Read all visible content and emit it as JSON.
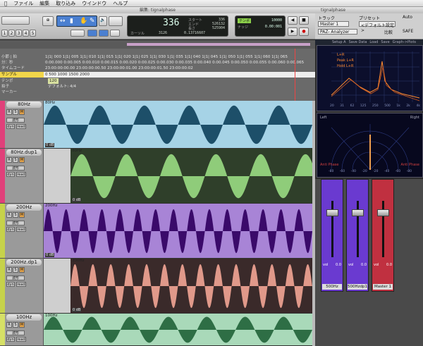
{
  "menu": [
    "ファイル",
    "編集",
    "取り込み",
    "ウインドウ",
    "ヘルプ"
  ],
  "edit_window_title": "編集: tignalphase",
  "plugin_window_title": "tignalphase",
  "counter": {
    "main": "336",
    "start_label": "スタート",
    "end_label": "エンド",
    "length_label": "長さ",
    "start": "336",
    "end": "526132",
    "length": "525904",
    "cursor_label": "カーソル",
    "cursor": "3126",
    "cursor_value": "0.13716607"
  },
  "transport": {
    "tempo_label": "テンポ",
    "tempo": "10000",
    "nudge_label": "ナッジ",
    "nudge": "0.00:001"
  },
  "toolbar": {
    "numbers": [
      "1",
      "2",
      "3",
      "4",
      "5"
    ]
  },
  "ruler": {
    "rows": [
      {
        "label": "小節 | 拍",
        "values": "1|1| 000  1|1| 005  1|1| 010  1|1| 015  1|1| 020  1|1| 025  1|1| 030  1|1| 035  1|1| 040  1|1| 045  1|1| 050  1|1| 055  1|1| 060  1|1| 065"
      },
      {
        "label": "分：秒",
        "values": "0:00.000  0:00.005  0:00.010  0:00.015  0:00.020  0:00.025  0:00.030  0:00.035  0:00.040  0:00.045  0:00.050  0:00.055  0:00.060  0:00.065"
      },
      {
        "label": "タイムコード",
        "values": "23:00:00:00.00          23:00:00:00.50          23:00:00:01.00          23:00:00:01.50          23:00:00:02"
      },
      {
        "label": "サンプル",
        "values": "0          500          1000          1500          2000"
      },
      {
        "label": "テンポ",
        "values": "120"
      },
      {
        "label": "拍子",
        "values": "デフォルト: 4/4"
      },
      {
        "label": "マーカー",
        "values": ""
      }
    ]
  },
  "tracks": [
    {
      "name": "80Hz",
      "color": "#e0407a",
      "clip": "80Hz",
      "wave_fill": "#1d4f69",
      "bg": "#a6d3e6",
      "cycles": 6,
      "offset": 0,
      "gain": "0 dB"
    },
    {
      "name": "80Hz.dup1",
      "color": "#e0407a",
      "clip": "80Hz",
      "wave_fill": "#8fcc7a",
      "bg": "#2f3f2a",
      "cycles": 6,
      "offset": 38,
      "gain": "0 dB"
    },
    {
      "name": "200Hz",
      "color": "#c6d24a",
      "clip": "200Hz",
      "wave_fill": "#3a0a6a",
      "bg": "#a884d6",
      "cycles": 15,
      "offset": 0,
      "gain": "0 dB"
    },
    {
      "name": "200Hz.dp1",
      "color": "#c6d24a",
      "clip": "200Hz",
      "wave_fill": "#e0998a",
      "bg": "#3a2a2a",
      "cycles": 15,
      "offset": 38,
      "gain": "0 dB"
    },
    {
      "name": "100Hz",
      "color": "#d6e066",
      "clip": "100Hz",
      "wave_fill": "#2e6e45",
      "bg": "#a9d9b9",
      "cycles": 7,
      "offset": 0,
      "gain": ""
    }
  ],
  "track_buttons": [
    "R",
    "S",
    "M"
  ],
  "track_controls": [
    "波形",
    "dyn",
    "read"
  ],
  "plugin": {
    "track_label": "トラック",
    "preset_label": "プリセット",
    "auto_label": "Auto",
    "track_value": "Master 1",
    "preset_value": "<デフォルト設定>",
    "plugin_name": "PAZ- Analyzer",
    "compare": "比較",
    "safe": "SAFE",
    "bar_items": [
      "Setup A",
      "Save Data",
      "Load",
      "Save",
      "Graph->Plots"
    ],
    "analyzer_legend": [
      "L+R",
      "Peak L+R",
      "Hold L+R"
    ],
    "freq_ticks": [
      "20",
      "31",
      "62",
      "125",
      "250",
      "500",
      "1k",
      "2k",
      "4k"
    ],
    "phase_left": "Left",
    "phase_right": "Right",
    "phase_anti_left": "Anti Phase",
    "phase_anti_right": "Anti Phase",
    "phase_ticks": [
      "-80",
      "-60",
      "-40",
      "-20",
      "-20",
      "-40",
      "-60",
      "-80"
    ]
  },
  "mixer": [
    {
      "name": "500Hz",
      "color": "#6a3ad0",
      "vol": "vol",
      "val": "0.0"
    },
    {
      "name": "500Hzdp1",
      "color": "#6a3ad0",
      "vol": "vol",
      "val": "0.0"
    },
    {
      "name": "Master 1",
      "color": "#c03040",
      "vol": "vol",
      "val": "0.0"
    }
  ]
}
